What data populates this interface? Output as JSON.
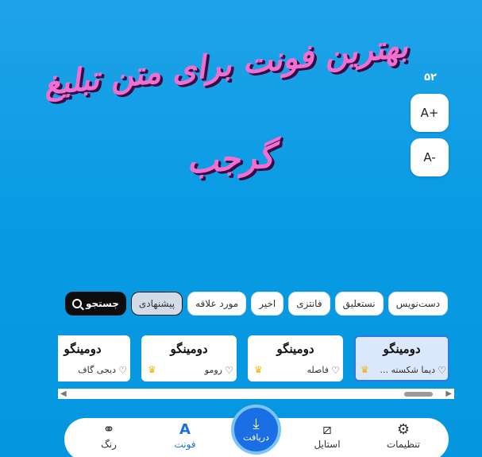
{
  "preview": {
    "line1": "بهترین فونت برای متن تبلیغ",
    "line2": "گرجب",
    "color": "#f06fd0"
  },
  "size_control": {
    "value": "۵۲",
    "increase_label": "A+",
    "decrease_label": "A-"
  },
  "filters": {
    "search_label": "جستجو",
    "items": [
      {
        "label": "پیشنهادی",
        "active": true
      },
      {
        "label": "مورد علاقه",
        "active": false
      },
      {
        "label": "اخیر",
        "active": false
      },
      {
        "label": "فانتزی",
        "active": false
      },
      {
        "label": "نستعلیق",
        "active": false
      },
      {
        "label": "دست‌نویس",
        "active": false
      }
    ]
  },
  "fonts": [
    {
      "sample": "دومینگو",
      "name": "دیما شکسته ...",
      "selected": true,
      "premium": true
    },
    {
      "sample": "دومینگو",
      "name": "فاصله",
      "selected": false,
      "premium": true
    },
    {
      "sample": "دومینگو",
      "name": "رومو",
      "selected": false,
      "premium": true
    },
    {
      "sample": "دومینگو",
      "name": "دیجی گاف",
      "selected": false,
      "premium": false
    }
  ],
  "nav": {
    "settings": "تنظیمات",
    "style": "استایل",
    "download": "دریافت",
    "font": "فونت",
    "color": "رنگ"
  },
  "colors": {
    "accent": "#1a6fe5",
    "background": "#0a9be4"
  }
}
